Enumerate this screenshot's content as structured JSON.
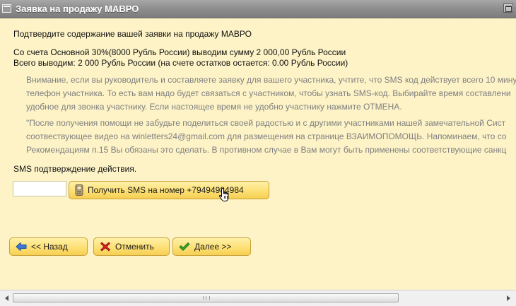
{
  "window": {
    "title": "Заявка на продажу МАВРО",
    "title_icon": "window-icon",
    "maximize_icon": "maximize-icon"
  },
  "content": {
    "heading": "Подтвердите содержание вашей заявки на продажу МАВРО",
    "summary_line1": "Со счета Основной 30%(8000 Рубль России) выводим сумму 2 000,00 Рубль России",
    "summary_line2": "Всего выводим: 2 000 Рубль России (на счете остатков остается: 0.00 Рубль России)",
    "notice1": [
      "Внимание, если вы руководитель и составляете заявку для вашего участника, учтите, что SMS код действует всего 10 мину",
      "телефон участника. То есть вам надо будет связаться с участником, чтобы узнать SMS-код. Выбирайте время составлени",
      "удобное для звонка участнику. Если настоящее время не удобно участнику нажмите ОТМЕНА."
    ],
    "notice2": [
      "\"После получения помощи не забудьте поделиться своей радостью и с другими участниками нашей замечательной Сист",
      "соотвествующее видео на winletters24@gmail.com для размещения на странице ВЗАИМОПОМОЩЬ. Напоминаем, что со",
      "Рекомендациям п.15 Вы обязаны это сделать. В противном случае в Вам могут быть применены соответствующие санкц"
    ],
    "sms_label": "SMS подтверждение действия.",
    "sms_input": {
      "value": "",
      "placeholder": ""
    },
    "sms_button": {
      "label": "Получить SMS на номер +79494984984",
      "icon": "phone-icon"
    }
  },
  "nav": {
    "back": {
      "label": "<< Назад",
      "icon": "back-arrow-icon",
      "icon_color": "#3a78d6"
    },
    "cancel": {
      "label": "Отменить",
      "icon": "red-x-icon",
      "icon_color": "#d62020"
    },
    "next": {
      "label": "Далее >>",
      "icon": "green-check-icon",
      "icon_color": "#3aa12a"
    }
  },
  "colors": {
    "background": "#fdf3c7",
    "button_fill": "#fde27a",
    "button_border": "#c8a13a",
    "titlebar": "#8d8d8d",
    "notice_text": "#7f7f7f"
  }
}
